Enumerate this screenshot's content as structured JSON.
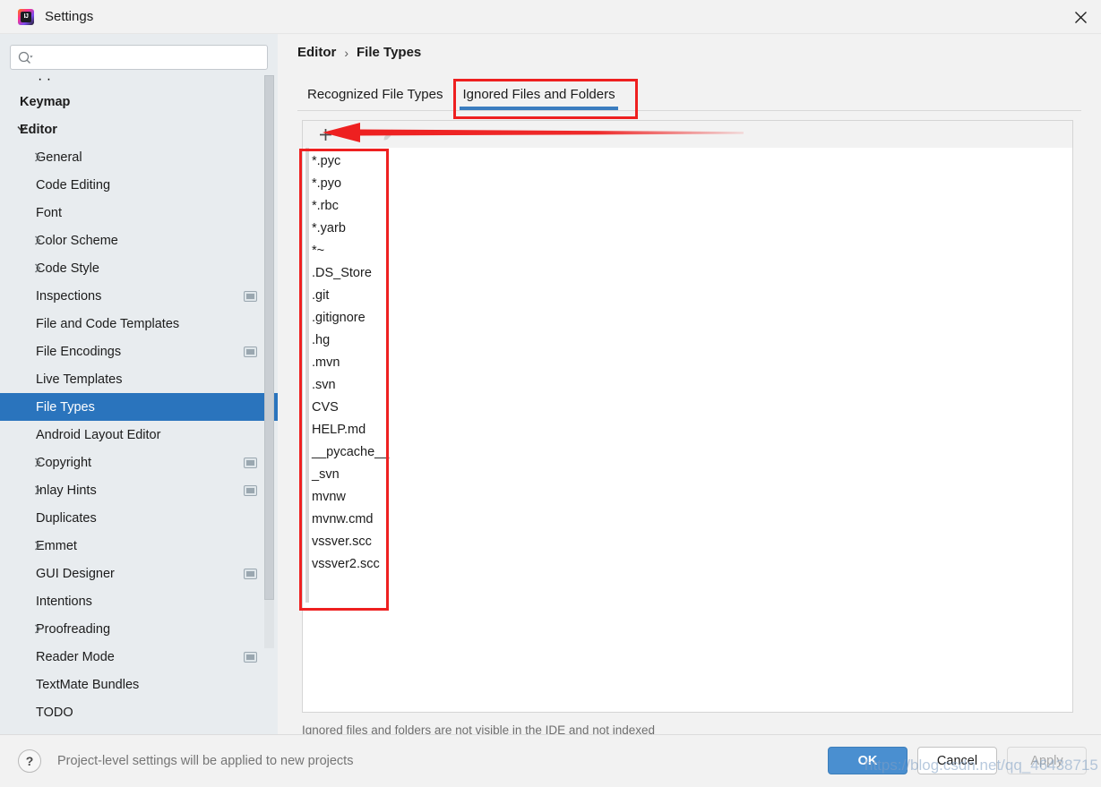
{
  "window": {
    "title": "Settings",
    "app_icon": "intellij-idea-icon",
    "close_label": "×"
  },
  "search": {
    "value": "",
    "placeholder": "",
    "icon": "search-icon"
  },
  "sidebar": {
    "partial_top_item": "· ·",
    "items": [
      {
        "label": "Keymap",
        "depth": 1,
        "bold": true,
        "arrow": "",
        "badge": false,
        "selected": false
      },
      {
        "label": "Editor",
        "depth": 1,
        "bold": true,
        "arrow": "chevron-down-icon",
        "badge": false,
        "selected": false
      },
      {
        "label": "General",
        "depth": 2,
        "bold": false,
        "arrow": "chevron-right-icon",
        "badge": false,
        "selected": false
      },
      {
        "label": "Code Editing",
        "depth": 2,
        "bold": false,
        "arrow": "",
        "badge": false,
        "selected": false
      },
      {
        "label": "Font",
        "depth": 2,
        "bold": false,
        "arrow": "",
        "badge": false,
        "selected": false
      },
      {
        "label": "Color Scheme",
        "depth": 2,
        "bold": false,
        "arrow": "chevron-right-icon",
        "badge": false,
        "selected": false
      },
      {
        "label": "Code Style",
        "depth": 2,
        "bold": false,
        "arrow": "chevron-right-icon",
        "badge": false,
        "selected": false
      },
      {
        "label": "Inspections",
        "depth": 2,
        "bold": false,
        "arrow": "",
        "badge": true,
        "selected": false
      },
      {
        "label": "File and Code Templates",
        "depth": 2,
        "bold": false,
        "arrow": "",
        "badge": false,
        "selected": false
      },
      {
        "label": "File Encodings",
        "depth": 2,
        "bold": false,
        "arrow": "",
        "badge": true,
        "selected": false
      },
      {
        "label": "Live Templates",
        "depth": 2,
        "bold": false,
        "arrow": "",
        "badge": false,
        "selected": false
      },
      {
        "label": "File Types",
        "depth": 2,
        "bold": false,
        "arrow": "",
        "badge": false,
        "selected": true
      },
      {
        "label": "Android Layout Editor",
        "depth": 2,
        "bold": false,
        "arrow": "",
        "badge": false,
        "selected": false
      },
      {
        "label": "Copyright",
        "depth": 2,
        "bold": false,
        "arrow": "chevron-right-icon",
        "badge": true,
        "selected": false
      },
      {
        "label": "Inlay Hints",
        "depth": 2,
        "bold": false,
        "arrow": "chevron-right-icon",
        "badge": true,
        "selected": false
      },
      {
        "label": "Duplicates",
        "depth": 2,
        "bold": false,
        "arrow": "",
        "badge": false,
        "selected": false
      },
      {
        "label": "Emmet",
        "depth": 2,
        "bold": false,
        "arrow": "chevron-right-icon",
        "badge": false,
        "selected": false
      },
      {
        "label": "GUI Designer",
        "depth": 2,
        "bold": false,
        "arrow": "",
        "badge": true,
        "selected": false
      },
      {
        "label": "Intentions",
        "depth": 2,
        "bold": false,
        "arrow": "",
        "badge": false,
        "selected": false
      },
      {
        "label": "Proofreading",
        "depth": 2,
        "bold": false,
        "arrow": "chevron-right-icon",
        "badge": false,
        "selected": false
      },
      {
        "label": "Reader Mode",
        "depth": 2,
        "bold": false,
        "arrow": "",
        "badge": true,
        "selected": false
      },
      {
        "label": "TextMate Bundles",
        "depth": 2,
        "bold": false,
        "arrow": "",
        "badge": false,
        "selected": false
      },
      {
        "label": "TODO",
        "depth": 2,
        "bold": false,
        "arrow": "",
        "badge": false,
        "selected": false
      }
    ]
  },
  "main": {
    "breadcrumb": {
      "root": "Editor",
      "separator": "›",
      "current": "File Types"
    },
    "tabs": [
      {
        "label": "Recognized File Types",
        "active": false
      },
      {
        "label": "Ignored Files and Folders",
        "active": true
      }
    ],
    "toolbar": {
      "add_icon": "plus-icon",
      "edit_icon": "pencil-icon"
    },
    "ignored_items": [
      "*.pyc",
      "*.pyo",
      "*.rbc",
      "*.yarb",
      "*~",
      ".DS_Store",
      ".git",
      ".gitignore",
      ".hg",
      ".mvn",
      ".svn",
      "CVS",
      "HELP.md",
      "__pycache__",
      "_svn",
      "mvnw",
      "mvnw.cmd",
      "vssver.scc",
      "vssver2.scc"
    ],
    "hint": "Ignored files and folders are not visible in the IDE and not indexed"
  },
  "footer": {
    "help_icon": "question-mark-icon",
    "note": "Project-level settings will be applied to new projects",
    "buttons": [
      {
        "label": "OK",
        "style": "primary"
      },
      {
        "label": "Cancel",
        "style": "normal"
      },
      {
        "label": "Apply",
        "style": "disabled"
      }
    ]
  },
  "annotations": {
    "tab_highlight_color": "#ee2020",
    "list_highlight_color": "#ee2020",
    "arrow_color": "#ee2020",
    "arrow_direction": "left"
  },
  "watermark": {
    "text": "https://blog.csdn.net/qq_46438715"
  },
  "colors": {
    "selection_blue": "#2a74bd",
    "tab_underline": "#3b7dbf",
    "ok_button": "#4a8fd0",
    "sidebar_bg": "#e8ecef",
    "panel_bg": "#f2f2f2"
  }
}
